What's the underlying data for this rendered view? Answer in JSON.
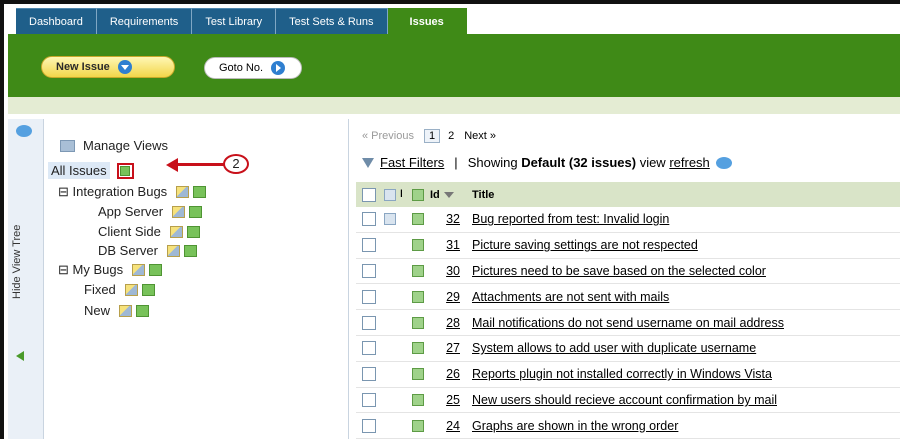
{
  "tabs": [
    "Dashboard",
    "Requirements",
    "Test Library",
    "Test Sets & Runs",
    "Issues"
  ],
  "active_tab": "Issues",
  "toolbar": {
    "new_issue": "New Issue",
    "goto": "Goto No."
  },
  "rail": {
    "hide_label": "Hide View Tree"
  },
  "tree": {
    "manage_views": "Manage Views",
    "all_issues": "All Issues",
    "callout_number": "2",
    "integration_bugs": "⊟ Integration Bugs",
    "app_server": "App Server",
    "client_side": "Client Side",
    "db_server": "DB Server",
    "my_bugs": "⊟ My Bugs",
    "fixed": "Fixed",
    "new": "New"
  },
  "pager": {
    "previous": "« Previous",
    "page1": "1",
    "page2": "2",
    "next": "Next »"
  },
  "filters": {
    "fast_filters": "Fast Filters",
    "sep": "|",
    "showing_prefix": "Showing",
    "view_bold": "Default (32 issues)",
    "view_suffix": "view",
    "refresh": "refresh"
  },
  "table": {
    "headers": {
      "id": "Id",
      "title": "Title"
    },
    "rows": [
      {
        "id": "32",
        "title": "Bug reported from test: Invalid login",
        "note": true
      },
      {
        "id": "31",
        "title": "Picture saving settings are not respected",
        "note": false
      },
      {
        "id": "30",
        "title": "Pictures need to be save based on the selected color",
        "note": false
      },
      {
        "id": "29",
        "title": "Attachments are not sent with mails",
        "note": false
      },
      {
        "id": "28",
        "title": "Mail notifications do not send username on mail address",
        "note": false
      },
      {
        "id": "27",
        "title": "System allows to add user with duplicate username",
        "note": false
      },
      {
        "id": "26",
        "title": "Reports plugin not installed correctly in Windows Vista",
        "note": false
      },
      {
        "id": "25",
        "title": "New users should recieve account confirmation by mail",
        "note": false
      },
      {
        "id": "24",
        "title": "Graphs are shown in the wrong order",
        "note": false
      }
    ]
  }
}
